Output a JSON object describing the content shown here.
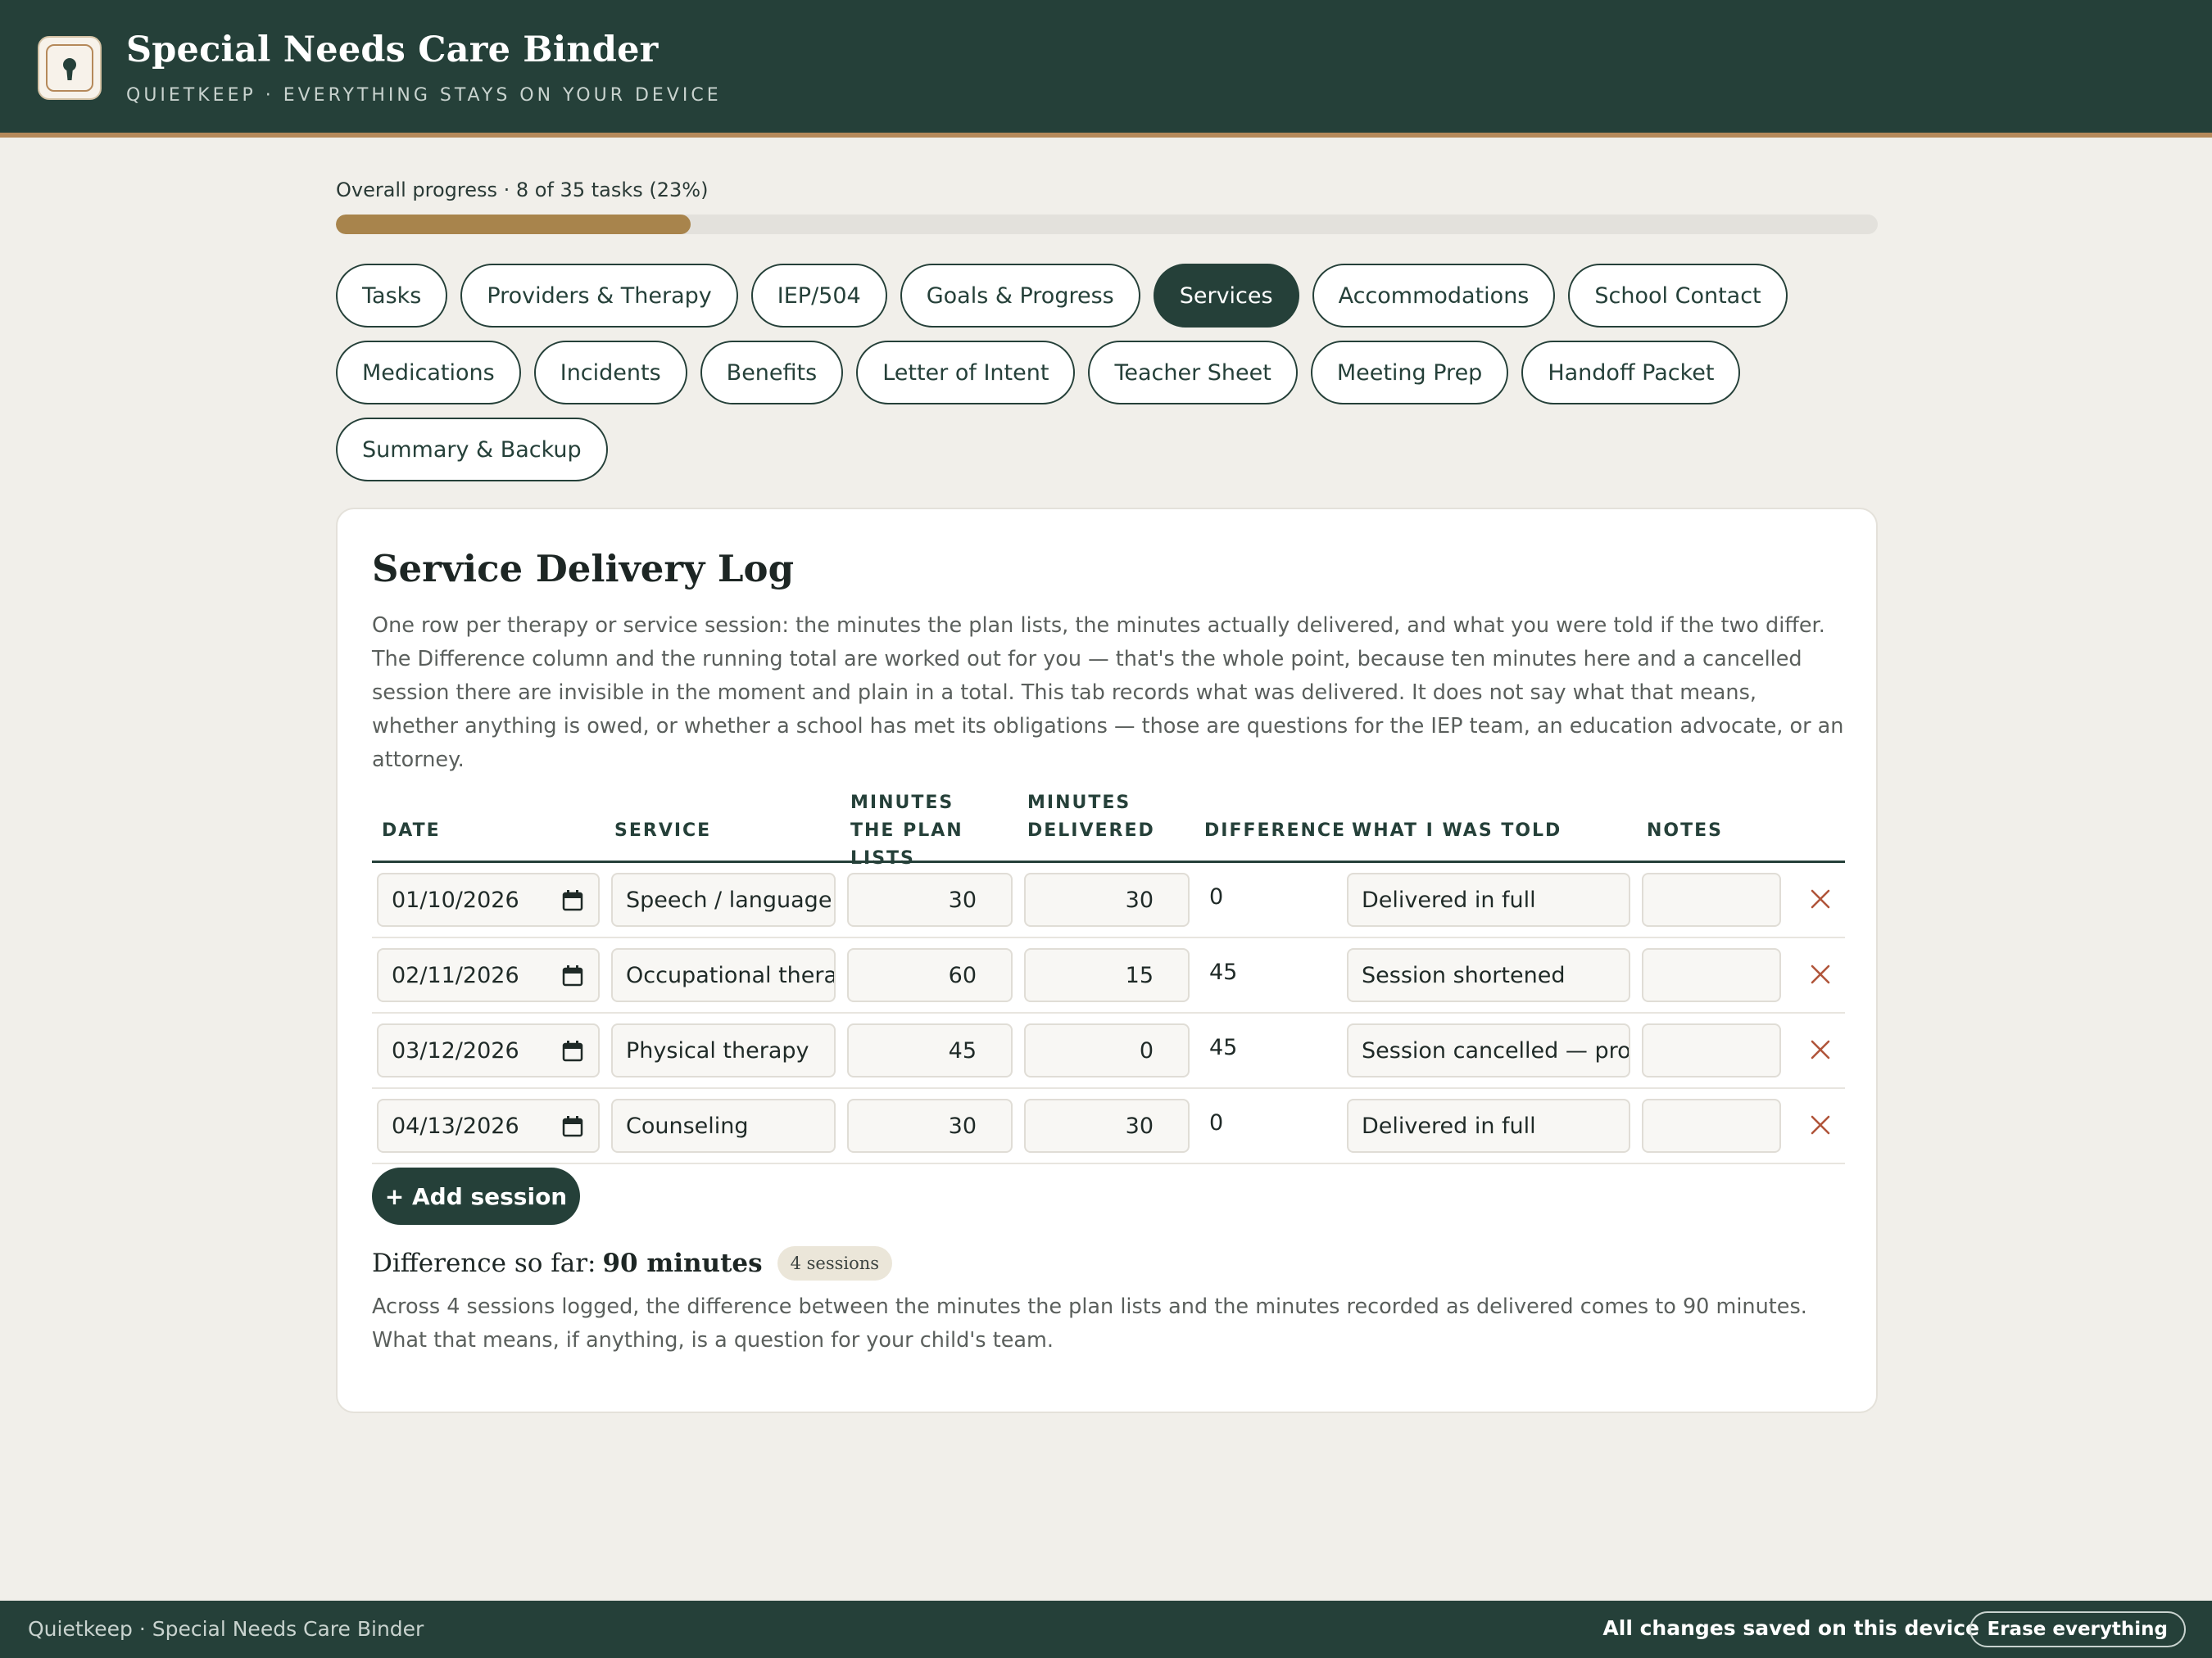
{
  "header": {
    "title": "Special Needs Care Binder",
    "subtitle": "Quietkeep · Everything stays on your device",
    "logo_icon": "keyhole-icon"
  },
  "progress": {
    "label": "Overall progress · 8 of 35 tasks (23%)",
    "fraction": 0.23
  },
  "tabs": [
    {
      "label": "Tasks",
      "active": false
    },
    {
      "label": "Providers & Therapy",
      "active": false
    },
    {
      "label": "IEP/504",
      "active": false
    },
    {
      "label": "Goals & Progress",
      "active": false
    },
    {
      "label": "Services",
      "active": true
    },
    {
      "label": "Accommodations",
      "active": false
    },
    {
      "label": "School Contact",
      "active": false
    },
    {
      "label": "Medications",
      "active": false
    },
    {
      "label": "Incidents",
      "active": false
    },
    {
      "label": "Benefits",
      "active": false
    },
    {
      "label": "Letter of Intent",
      "active": false
    },
    {
      "label": "Teacher Sheet",
      "active": false
    },
    {
      "label": "Meeting Prep",
      "active": false
    },
    {
      "label": "Handoff Packet",
      "active": false
    },
    {
      "label": "Summary & Backup",
      "active": false
    }
  ],
  "section": {
    "title": "Service Delivery Log",
    "description": "One row per therapy or service session: the minutes the plan lists, the minutes actually delivered, and what you were told if the two differ. The Difference column and the running total are worked out for you — that's the whole point, because ten minutes here and a cancelled session there are invisible in the moment and plain in a total. This tab records what was delivered. It does not say what that means, whether anything is owed, or whether a school has met its obligations — those are questions for the IEP team, an education advocate, or an attorney."
  },
  "table": {
    "headers": {
      "date": "Date",
      "service": "Service",
      "plan_minutes": "Minutes the plan lists",
      "delivered_minutes": "Minutes delivered",
      "difference": "Difference",
      "told": "What I was told",
      "notes": "Notes"
    },
    "rows": [
      {
        "date": "01/10/2026",
        "service": "Speech / language",
        "plan": "30",
        "delivered": "30",
        "difference": "0",
        "told": "Delivered in full",
        "notes": ""
      },
      {
        "date": "02/11/2026",
        "service": "Occupational therapy",
        "plan": "60",
        "delivered": "15",
        "difference": "45",
        "told": "Session shortened",
        "notes": ""
      },
      {
        "date": "03/12/2026",
        "service": "Physical therapy",
        "plan": "45",
        "delivered": "0",
        "difference": "45",
        "told": "Session cancelled — provider",
        "notes": ""
      },
      {
        "date": "04/13/2026",
        "service": "Counseling",
        "plan": "30",
        "delivered": "30",
        "difference": "0",
        "told": "Delivered in full",
        "notes": ""
      }
    ],
    "add_label": "+ Add session"
  },
  "total": {
    "prefix": "Difference so far:",
    "value": "90 minutes",
    "badge": "4 sessions",
    "description": "Across 4 sessions logged, the difference between the minutes the plan lists and the minutes recorded as delivered comes to 90 minutes. What that means, if anything, is a question for your child's team."
  },
  "footer": {
    "left": "Quietkeep · Special Needs Care Binder",
    "status": "All changes saved on this device",
    "erase_label": "Erase everything"
  },
  "colors": {
    "primary": "#254039",
    "accent": "#b5895a",
    "progress": "#a8844c",
    "delete": "#b0553a"
  }
}
